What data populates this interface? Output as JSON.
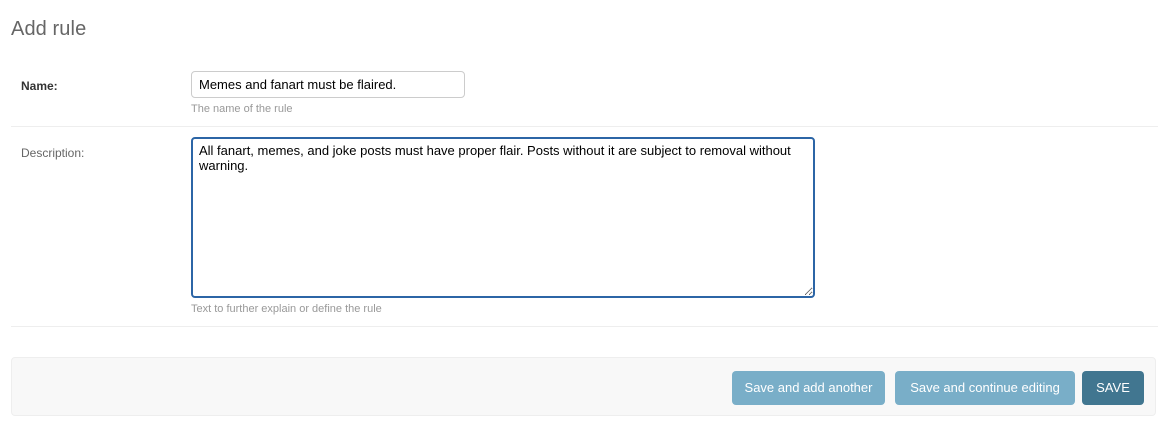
{
  "page": {
    "title": "Add rule"
  },
  "form": {
    "name": {
      "label": "Name:",
      "value": "Memes and fanart must be flaired.",
      "help": "The name of the rule"
    },
    "description": {
      "label": "Description:",
      "value": "All fanart, memes, and joke posts must have proper flair. Posts without it are subject to removal without warning.",
      "help": "Text to further explain or define the rule"
    }
  },
  "actions": {
    "save_add_another": "Save and add another",
    "save_continue": "Save and continue editing",
    "save": "SAVE"
  },
  "colors": {
    "focus_border": "#2c65a6",
    "secondary_button": "#79aec8",
    "primary_button": "#417690",
    "submit_row_bg": "#f8f8f8"
  }
}
